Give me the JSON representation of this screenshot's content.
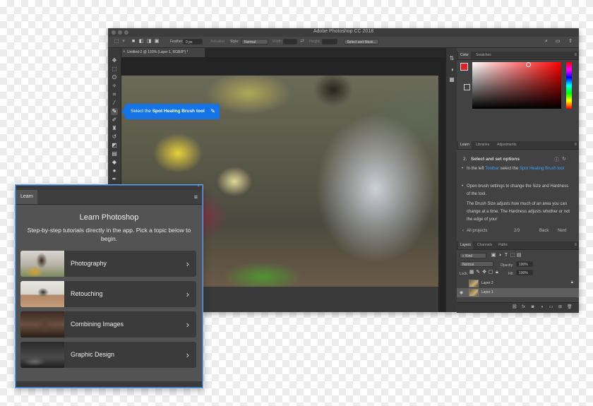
{
  "app": {
    "title": "Adobe Photoshop CC 2018"
  },
  "options_bar": {
    "feather_label": "Feather:",
    "feather_value": "0 px",
    "antialias_label": "Anti-alias",
    "style_label": "Style:",
    "style_value": "Normal",
    "width_label": "Width:",
    "height_label": "Height:",
    "select_mask_button": "Select and Mask..."
  },
  "document": {
    "tab_title": "Untitled-2 @ 193% (Layer 1, RGB/8*) *"
  },
  "tooltip": {
    "prefix": "Select the ",
    "tool_name": "Spot Healing Brush tool"
  },
  "color_panel": {
    "tabs": [
      "Color",
      "Swatches"
    ],
    "foreground": "#e21f26",
    "background": "#ffffff"
  },
  "learn_mini_panel": {
    "tabs": [
      "Learn",
      "Libraries",
      "Adjustments"
    ],
    "step_number": "2.",
    "step_title": "Select and set options",
    "bullet1_before": "In the left ",
    "bullet1_highlight1": "Toolbar",
    "bullet1_middle": " select the ",
    "bullet1_highlight2": "Spot Healing Brush tool",
    "bullet2": "Open brush settings to change the Size and Hardness of the tool.",
    "bullet3": "The Brush Size adjusts how much of an area you can change at a time. The Hardness adjusts whether or not the edge of your",
    "back_link": "All projects",
    "progress": "2/3",
    "back_button": "Back",
    "next_button": "Next"
  },
  "layers_panel": {
    "tabs": [
      "Layers",
      "Channels",
      "Paths"
    ],
    "kind_label": "Kind",
    "blend_mode": "Normal",
    "opacity_label": "Opacity:",
    "opacity_value": "100%",
    "lock_label": "Lock:",
    "fill_label": "Fill:",
    "fill_value": "100%",
    "layers": [
      {
        "name": "Layer 2"
      },
      {
        "name": "Layer 1"
      }
    ]
  },
  "learn_panel": {
    "tab": "Learn",
    "heading": "Learn Photoshop",
    "subheading": "Step-by-step tutorials directly in the app. Pick a topic below to begin.",
    "topics": [
      {
        "label": "Photography"
      },
      {
        "label": "Retouching"
      },
      {
        "label": "Combining Images"
      },
      {
        "label": "Graphic Design"
      }
    ]
  }
}
